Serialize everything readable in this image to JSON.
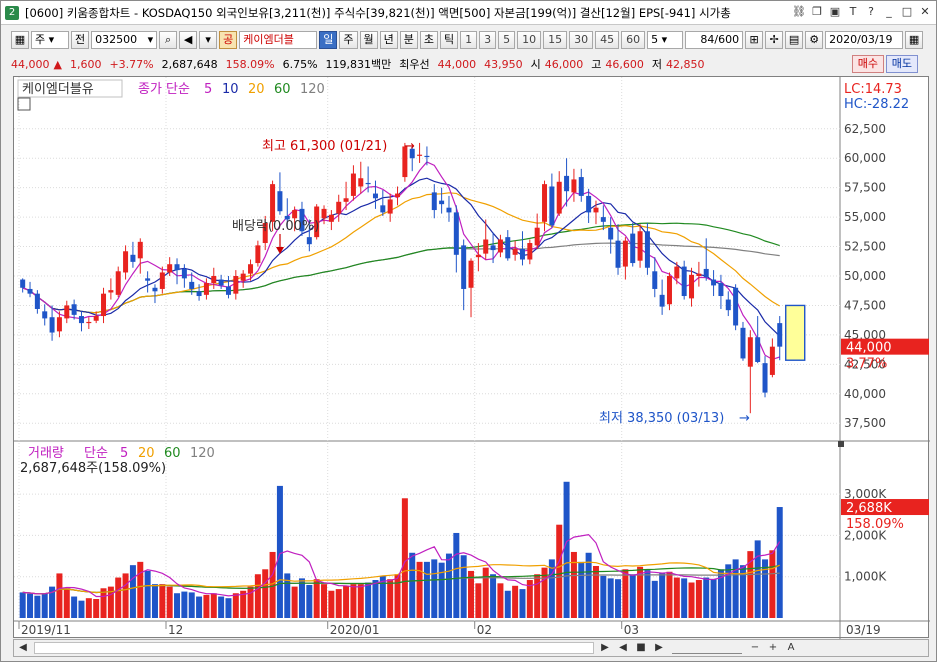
{
  "window": {
    "title": "[0600] 키움종합차트 - KOSDAQ150 외국인보유[3,211(천)] 주식수[39,821(천)] 액면[500] 자본금[199(억)] 결산[12월] EPS[-941] 시가총",
    "icon_label": "2"
  },
  "toolbar": {
    "period_select": "주",
    "prev_label": "전",
    "code": "032500",
    "stock_type_badge": "공",
    "stock_name": "케이엠더블",
    "interval_buttons": [
      "일",
      "주",
      "월",
      "년",
      "분",
      "초",
      "틱"
    ],
    "selected_interval": "일",
    "numeric_buttons": [
      "1",
      "3",
      "5",
      "10",
      "15",
      "30",
      "45",
      "60"
    ],
    "count_select": "5",
    "page_count": "84/600",
    "date": "2020/03/19"
  },
  "quote": {
    "price": "44,000",
    "arrow": "▲",
    "change": "1,600",
    "change_pct": "+3.77%",
    "volume": "2,687,648",
    "volume_pct": "158.09%",
    "turnover_pct": "6.75%",
    "trade_amount": "119,831백만",
    "priority_label": "최우선",
    "ask": "44,000",
    "bid": "43,950",
    "open_label": "시",
    "open": "46,000",
    "high_label": "고",
    "high": "46,600",
    "low_label": "저",
    "low": "42,850",
    "buy_label": "매수",
    "sell_label": "매도"
  },
  "price_panel": {
    "legend_name": "케이엠더블유",
    "ma_label": "종가 단순",
    "ma_periods": [
      "5",
      "10",
      "20",
      "60",
      "120"
    ],
    "lc_label": "LC:14.73",
    "hc_label": "HC:-28.22",
    "high_annotation": "최고 61,300 (01/21)",
    "low_annotation": "최저 38,350 (03/13)",
    "dividend_annotation": "배당락(0.00%)",
    "current_price_tag": "44,000",
    "current_pct_tag": "3.77%",
    "y_ticks": [
      "62,500",
      "60,000",
      "57,500",
      "55,000",
      "52,500",
      "50,000",
      "47,500",
      "45,000",
      "42,500",
      "40,000",
      "37,500"
    ]
  },
  "volume_panel": {
    "legend_name": "거래량",
    "ma_label": "단순",
    "ma_periods": [
      "5",
      "20",
      "60",
      "120"
    ],
    "current_volume": "2,687,648주(158.09%)",
    "current_tag": "2,688K",
    "current_pct_tag": "158.09%",
    "y_ticks": [
      "3,000K",
      "2,000K",
      "1,000K"
    ]
  },
  "x_labels": [
    "2019/11",
    "12",
    "2020/01",
    "02",
    "03"
  ],
  "x_last_label": "03/19",
  "colors": {
    "up": "#e8231f",
    "down": "#1f55c8",
    "ma5": "#c020c0",
    "ma10": "#1a2aa8",
    "ma20": "#f0a000",
    "ma60": "#208a20",
    "ma120": "#808080",
    "ma_vol5": "#c020c0",
    "ma_vol20": "#f0a000",
    "ma_vol60": "#208a20",
    "ma_vol120": "#808080"
  },
  "chart_data": {
    "type": "candlestick",
    "price_ylim": [
      36500,
      63500
    ],
    "volume_ylim": [
      0,
      3900
    ],
    "volume_unit": "K",
    "x_category_labels": {
      "0": "2019/11",
      "20": "12",
      "42": "2020/01",
      "62": "02",
      "82": "03",
      "103": "03/19"
    },
    "ohlc": [
      [
        49700,
        49800,
        48600,
        49000
      ],
      [
        48900,
        49500,
        48200,
        48500
      ],
      [
        48500,
        48800,
        46800,
        47200
      ],
      [
        47000,
        47600,
        45800,
        46400
      ],
      [
        46500,
        47500,
        44500,
        45200
      ],
      [
        45300,
        47000,
        44800,
        46500
      ],
      [
        46400,
        47900,
        46000,
        47500
      ],
      [
        47600,
        48000,
        46300,
        46700
      ],
      [
        46600,
        47000,
        45300,
        46000
      ],
      [
        46000,
        46500,
        45500,
        46100
      ],
      [
        46200,
        47000,
        46000,
        46600
      ],
      [
        46600,
        49000,
        46000,
        48500
      ],
      [
        48600,
        49800,
        48000,
        48800
      ],
      [
        48400,
        50800,
        48200,
        50400
      ],
      [
        50300,
        52600,
        49700,
        52100
      ],
      [
        51800,
        52900,
        50700,
        51200
      ],
      [
        51500,
        53200,
        50200,
        52900
      ],
      [
        49800,
        50400,
        48600,
        49600
      ],
      [
        49000,
        49300,
        47700,
        48700
      ],
      [
        48900,
        50800,
        48500,
        50300
      ],
      [
        50300,
        51600,
        50000,
        51000
      ],
      [
        51000,
        51500,
        49300,
        50500
      ],
      [
        50600,
        51000,
        49000,
        49800
      ],
      [
        49500,
        50300,
        48400,
        48900
      ],
      [
        48700,
        49300,
        47900,
        48300
      ],
      [
        48400,
        49800,
        48000,
        49400
      ],
      [
        49400,
        50700,
        48900,
        50000
      ],
      [
        49700,
        50100,
        48900,
        49200
      ],
      [
        49100,
        50000,
        48100,
        48400
      ],
      [
        48500,
        50500,
        48000,
        50000
      ],
      [
        49600,
        50500,
        49000,
        50200
      ],
      [
        50200,
        51400,
        49600,
        51000
      ],
      [
        51100,
        53000,
        50800,
        52600
      ],
      [
        52800,
        55100,
        52200,
        54500
      ],
      [
        54600,
        58100,
        53800,
        57800
      ],
      [
        57200,
        58800,
        55200,
        55500
      ],
      [
        55100,
        56600,
        54100,
        54800
      ],
      [
        54900,
        55900,
        53800,
        55600
      ],
      [
        55700,
        56300,
        53400,
        53800
      ],
      [
        53300,
        54800,
        52100,
        52700
      ],
      [
        53300,
        56100,
        53100,
        55900
      ],
      [
        54900,
        56000,
        54400,
        55700
      ],
      [
        54600,
        55600,
        53900,
        55200
      ],
      [
        55300,
        56900,
        54600,
        56300
      ],
      [
        56300,
        58000,
        55600,
        56600
      ],
      [
        56800,
        59400,
        56400,
        58700
      ],
      [
        57600,
        59700,
        57000,
        58300
      ],
      [
        57900,
        59300,
        57100,
        57800
      ],
      [
        57000,
        58100,
        55700,
        56600
      ],
      [
        56000,
        57300,
        55100,
        55400
      ],
      [
        55300,
        57000,
        54600,
        56500
      ],
      [
        56700,
        57600,
        56000,
        57000
      ],
      [
        58400,
        61300,
        58000,
        61000
      ],
      [
        60800,
        61000,
        58900,
        60000
      ],
      [
        60200,
        61300,
        59600,
        60300
      ],
      [
        60200,
        61000,
        59400,
        60100
      ],
      [
        57100,
        57800,
        54900,
        55600
      ],
      [
        56400,
        57500,
        55300,
        56100
      ],
      [
        55800,
        56800,
        54600,
        55400
      ],
      [
        55400,
        56000,
        50300,
        51800
      ],
      [
        52600,
        53100,
        47100,
        48900
      ],
      [
        49000,
        51500,
        46500,
        51300
      ],
      [
        51600,
        52800,
        50400,
        51800
      ],
      [
        51900,
        54800,
        51400,
        53100
      ],
      [
        52600,
        53700,
        51100,
        52200
      ],
      [
        52000,
        53500,
        51600,
        53100
      ],
      [
        53300,
        53900,
        51300,
        51500
      ],
      [
        51800,
        53000,
        51300,
        52300
      ],
      [
        52300,
        53800,
        50900,
        51400
      ],
      [
        51400,
        53100,
        51000,
        52800
      ],
      [
        52600,
        55300,
        52300,
        54100
      ],
      [
        54600,
        58100,
        53800,
        57800
      ],
      [
        57600,
        58700,
        54100,
        54300
      ],
      [
        55300,
        58900,
        55100,
        58000
      ],
      [
        58500,
        60000,
        55900,
        57200
      ],
      [
        57100,
        59100,
        56300,
        58200
      ],
      [
        58400,
        59100,
        56300,
        56800
      ],
      [
        56800,
        57400,
        54500,
        55400
      ],
      [
        55400,
        56400,
        54400,
        55800
      ],
      [
        55000,
        56000,
        53900,
        54600
      ],
      [
        54100,
        55000,
        51900,
        53100
      ],
      [
        53000,
        54400,
        50100,
        50700
      ],
      [
        50800,
        53300,
        49700,
        53000
      ],
      [
        53600,
        54500,
        50800,
        51100
      ],
      [
        51300,
        54400,
        50700,
        53800
      ],
      [
        53800,
        54500,
        50100,
        50700
      ],
      [
        50400,
        51600,
        48200,
        48900
      ],
      [
        48400,
        49700,
        46700,
        47400
      ],
      [
        47600,
        50300,
        47100,
        50000
      ],
      [
        49800,
        51200,
        49300,
        50800
      ],
      [
        50800,
        51300,
        48000,
        48300
      ],
      [
        48100,
        50700,
        47400,
        50100
      ],
      [
        50000,
        51200,
        49100,
        50200
      ],
      [
        50600,
        53200,
        49600,
        49900
      ],
      [
        49700,
        50500,
        48300,
        49200
      ],
      [
        49400,
        50100,
        47200,
        48300
      ],
      [
        48000,
        48700,
        46600,
        47100
      ],
      [
        49000,
        49300,
        45400,
        45800
      ],
      [
        45600,
        46100,
        42800,
        43000
      ],
      [
        42300,
        45400,
        38350,
        44800
      ],
      [
        44800,
        46600,
        42600,
        42700
      ],
      [
        42600,
        43200,
        39700,
        40100
      ],
      [
        41600,
        44700,
        41400,
        44000
      ],
      [
        46000,
        46600,
        42850,
        44000
      ]
    ],
    "volumes": [
      620,
      590,
      540,
      600,
      760,
      1080,
      720,
      520,
      420,
      480,
      460,
      720,
      760,
      980,
      1080,
      1280,
      1360,
      1140,
      820,
      820,
      760,
      600,
      640,
      620,
      520,
      560,
      600,
      520,
      480,
      600,
      660,
      760,
      1060,
      1180,
      1600,
      3200,
      1080,
      760,
      960,
      800,
      940,
      820,
      660,
      700,
      780,
      820,
      820,
      860,
      920,
      1020,
      940,
      1060,
      2900,
      1580,
      1360,
      1360,
      1420,
      1340,
      1560,
      2060,
      1520,
      1140,
      840,
      1220,
      1060,
      840,
      660,
      780,
      700,
      920,
      1060,
      1220,
      1420,
      2260,
      3300,
      1600,
      1360,
      1580,
      1260,
      1020,
      960,
      940,
      1180,
      1060,
      1240,
      1160,
      900,
      1080,
      1120,
      980,
      960,
      860,
      920,
      980,
      940,
      1180,
      1300,
      1420,
      1280,
      1620,
      1880,
      1420,
      1640,
      2688
    ]
  }
}
